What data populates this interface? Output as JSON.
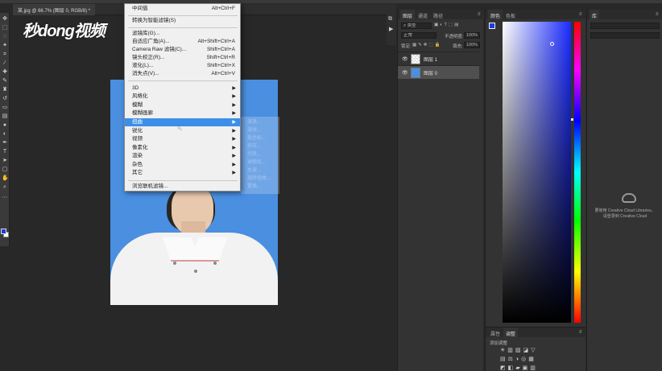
{
  "document_tab": "某.jpg @ 66.7% (图层 0, RGB/8) *",
  "watermark": "秒dong视频",
  "menu": {
    "items_top": [
      {
        "label": "中间值",
        "shortcut": "Alt+Ctrl+F"
      },
      {
        "label": "转换为智能滤镜(S)",
        "shortcut": ""
      }
    ],
    "items_mid": [
      {
        "label": "滤镜库(G)...",
        "shortcut": ""
      },
      {
        "label": "自适应广角(A)...",
        "shortcut": "Alt+Shift+Ctrl+A"
      },
      {
        "label": "Camera Raw 滤镜(C)...",
        "shortcut": "Shift+Ctrl+A"
      },
      {
        "label": "镜头校正(R)...",
        "shortcut": "Shift+Ctrl+R"
      },
      {
        "label": "液化(L)...",
        "shortcut": "Shift+Ctrl+X"
      },
      {
        "label": "消失点(V)...",
        "shortcut": "Alt+Ctrl+V"
      }
    ],
    "submenus": [
      "3D",
      "风格化",
      "模糊",
      "模糊画廊",
      "扭曲",
      "锐化",
      "视频",
      "像素化",
      "渲染",
      "杂色",
      "其它"
    ],
    "highlighted": "扭曲",
    "bottom": "浏览联机滤镜..."
  },
  "submenu_ghost": [
    "波浪...",
    "波纹...",
    "极坐标...",
    "挤压...",
    "切变...",
    "球面化...",
    "水波...",
    "旋转扭曲...",
    "置换..."
  ],
  "layers_panel": {
    "tabs": [
      "图层",
      "通道",
      "路径"
    ],
    "filter_kind": "类型",
    "blend_mode": "正常",
    "opacity_label": "不透明度:",
    "opacity_value": "100%",
    "lock_label": "锁定:",
    "fill_label": "填充:",
    "fill_value": "100%",
    "layers": [
      {
        "name": "图层 1",
        "selected": false
      },
      {
        "name": "图层 0",
        "selected": true
      }
    ]
  },
  "color_panel": {
    "tabs": [
      "颜色",
      "色板"
    ],
    "foreground": "#1a3fe0",
    "background": "#ffffff"
  },
  "adjust_panel": {
    "tabs": [
      "属性",
      "调整"
    ],
    "title": "添加调整"
  },
  "library_panel": {
    "tab": "库",
    "msg_line1": "要使用 Creative Cloud Libraries，",
    "msg_line2": "请登录到 Creative Cloud"
  }
}
